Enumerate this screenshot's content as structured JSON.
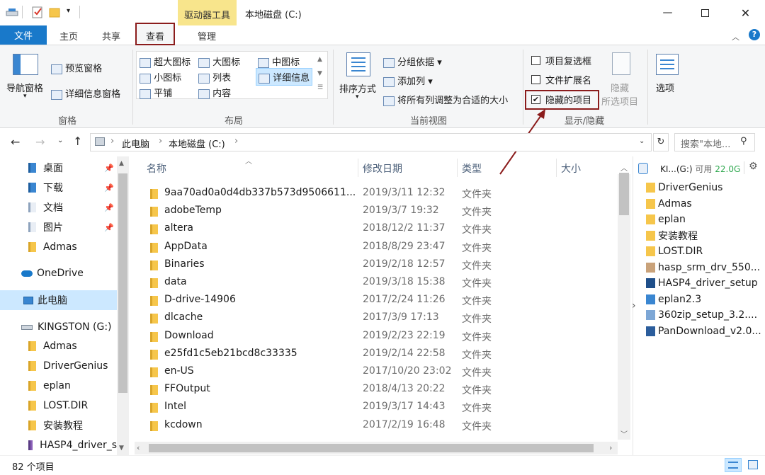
{
  "title_bar": {
    "contextual_tab": "驱动器工具",
    "window_title": "本地磁盘 (C:)",
    "controls": [
      "minimize-icon",
      "maximize-icon",
      "close-icon"
    ]
  },
  "ribbon_tabs": {
    "file": "文件",
    "home": "主页",
    "share": "共享",
    "view": "查看",
    "manage": "管理"
  },
  "ribbon": {
    "panes": {
      "nav_pane": "导航窗格",
      "preview_pane": "预览窗格",
      "details_pane": "详细信息窗格",
      "group": "窗格"
    },
    "layout": {
      "extra_large": "超大图标",
      "large": "大图标",
      "medium": "中图标",
      "small": "小图标",
      "list": "列表",
      "details": "详细信息",
      "tiles": "平铺",
      "content": "内容",
      "group": "布局"
    },
    "current_view": {
      "sort_by": "排序方式",
      "group_by": "分组依据",
      "add_columns": "添加列",
      "size_all_columns": "将所有列调整为合适的大小",
      "group": "当前视图"
    },
    "show_hide": {
      "item_checkboxes": "项目复选框",
      "file_extensions": "文件扩展名",
      "hidden_items": "隐藏的项目",
      "hide_selected_line1": "隐藏",
      "hide_selected_line2": "所选项目",
      "options": "选项",
      "group": "显示/隐藏"
    }
  },
  "address": {
    "path": [
      "此电脑",
      "本地磁盘 (C:)"
    ],
    "search_placeholder": "搜索\"本地..."
  },
  "nav_pane": {
    "quick_access": [
      {
        "label": "桌面",
        "pinned": true
      },
      {
        "label": "下载",
        "pinned": true
      },
      {
        "label": "文档",
        "pinned": true
      },
      {
        "label": "图片",
        "pinned": true
      },
      {
        "label": "Admas",
        "pinned": false
      }
    ],
    "onedrive": "OneDrive",
    "this_pc": "此电脑",
    "drive": "KINGSTON (G:)",
    "drive_items": [
      "Admas",
      "DriverGenius",
      "eplan",
      "LOST.DIR",
      "安装教程",
      "HASP4_driver_s"
    ]
  },
  "file_list": {
    "headers": {
      "name": "名称",
      "date": "修改日期",
      "type": "类型",
      "size": "大小"
    },
    "rows": [
      {
        "name": "9aa70ad0a0d4db337b573d9506611...",
        "date": "2019/3/11 12:32",
        "type": "文件夹"
      },
      {
        "name": "adobeTemp",
        "date": "2019/3/7 19:32",
        "type": "文件夹"
      },
      {
        "name": "altera",
        "date": "2018/12/2 11:37",
        "type": "文件夹"
      },
      {
        "name": "AppData",
        "date": "2018/8/29 23:47",
        "type": "文件夹"
      },
      {
        "name": "Binaries",
        "date": "2019/2/18 12:57",
        "type": "文件夹"
      },
      {
        "name": "data",
        "date": "2019/3/18 15:38",
        "type": "文件夹"
      },
      {
        "name": "D-drive-14906",
        "date": "2017/2/24 11:26",
        "type": "文件夹"
      },
      {
        "name": "dlcache",
        "date": "2017/3/9 17:13",
        "type": "文件夹"
      },
      {
        "name": "Download",
        "date": "2019/2/23 22:19",
        "type": "文件夹"
      },
      {
        "name": "e25fd1c5eb21bcd8c33335",
        "date": "2019/2/14 22:58",
        "type": "文件夹"
      },
      {
        "name": "en-US",
        "date": "2017/10/20 23:02",
        "type": "文件夹"
      },
      {
        "name": "FFOutput",
        "date": "2018/4/13 20:22",
        "type": "文件夹"
      },
      {
        "name": "Intel",
        "date": "2019/3/17 14:43",
        "type": "文件夹"
      },
      {
        "name": "kcdown",
        "date": "2017/2/19 16:48",
        "type": "文件夹"
      }
    ]
  },
  "preview_pane": {
    "drive_label": "KI...(G:)",
    "free_label": "可用",
    "free_value": "22.0G",
    "items": [
      "DriverGenius",
      "Admas",
      "eplan",
      "安装教程",
      "LOST.DIR",
      "hasp_srm_drv_550...",
      "HASP4_driver_setup",
      "eplan2.3",
      "360zip_setup_3.2....",
      "PanDownload_v2.0..."
    ]
  },
  "status_bar": {
    "count": "82 个项目"
  },
  "colors": {
    "accent": "#1979ca",
    "highlight_box": "#8b1c1c",
    "contextual_tab": "#f8e58c",
    "selection": "#cce8ff",
    "free_space": "#2fa84f"
  }
}
